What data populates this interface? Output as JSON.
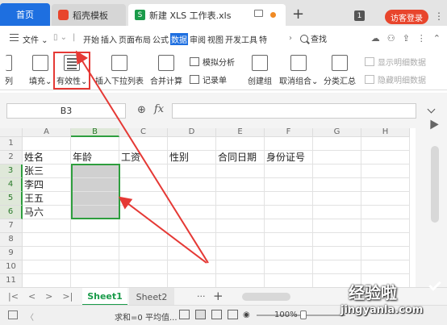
{
  "titlebar": {
    "tabs": [
      {
        "label": "首页"
      },
      {
        "label": "稻壳模板"
      },
      {
        "label": "新建 XLS 工作表.xls"
      }
    ],
    "plus_label": "+",
    "badge_count": "1",
    "visitor_label": "访客登录",
    "more_label": "⋮"
  },
  "menubar": {
    "file_label": "文件",
    "items": [
      "开始",
      "插入",
      "页面布局",
      "公式",
      "数据",
      "审阅",
      "视图",
      "开发工具",
      "特"
    ],
    "active_item": "数据",
    "search_label": "查找"
  },
  "ribbon": {
    "partial_left": "列",
    "fill": "填充",
    "validation": "有效性",
    "insert_dropdown": "插入下拉列表",
    "consolidate": "合并计算",
    "what_if": "模拟分析",
    "record": "记录单",
    "create_group": "创建组",
    "ungroup": "取消组合",
    "subtotal": "分类汇总",
    "show_detail": "显示明细数据",
    "hide_detail": "隐藏明细数据"
  },
  "formula_bar": {
    "name_box": "B3",
    "fx_label": "fx",
    "formula": ""
  },
  "grid": {
    "columns": [
      "A",
      "B",
      "C",
      "D",
      "E",
      "F",
      "G",
      "H"
    ],
    "rows": [
      "1",
      "2",
      "3",
      "4",
      "5",
      "6",
      "7",
      "8",
      "9",
      "10",
      "11"
    ],
    "cells": {
      "A2": "姓名",
      "B2": "年龄",
      "C2": "工资",
      "D2": "性别",
      "E2": "合同日期",
      "F2": "身份证号",
      "A3": "张三",
      "A4": "李四",
      "A5": "王五",
      "A6": "马六"
    },
    "selected_range": "B3:B6"
  },
  "sheets": {
    "tabs": [
      "Sheet1",
      "Sheet2"
    ],
    "active": "Sheet1",
    "more_label": "···",
    "add_label": "+"
  },
  "statusbar": {
    "sum_label": "求和=0",
    "avg_label": "平均值...",
    "zoom_label": "100%"
  },
  "watermark": {
    "title": "经验啦",
    "url": "jingyanla.com"
  },
  "colors": {
    "accent": "#1e6fe0",
    "selection_border": "#2e9e3e",
    "annotation": "#e53935",
    "visitor_button": "#e8452c"
  }
}
